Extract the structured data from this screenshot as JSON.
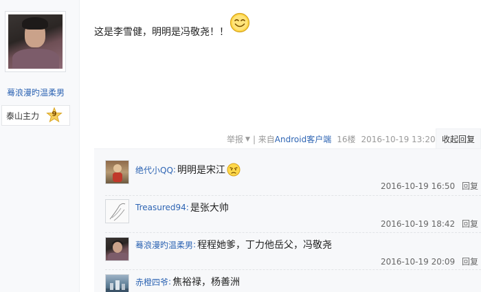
{
  "author": {
    "name": "蓦浪漫旳温柔男",
    "level_name": "泰山主力",
    "level_num": "9"
  },
  "post": {
    "text": "这是李雪健，明明是冯敬尧！！",
    "report": "举报",
    "source_prefix": "| 来自",
    "source_client": "Android客户端",
    "floor": "16楼",
    "time": "2016-10-19 13:20",
    "collapse_label": "收起回复"
  },
  "replies": [
    {
      "user": "绝代小QQ",
      "colon": ":",
      "text": "明明是宋江",
      "time": "2016-10-19 16:50",
      "reply_label": "回复",
      "avatar": "avatar-figure"
    },
    {
      "user": "Treasured94",
      "colon": ":",
      "text": "是张大帅",
      "time": "2016-10-19 18:42",
      "reply_label": "回复",
      "avatar": "avatar-sketch"
    },
    {
      "user": "蓦浪漫旳温柔男",
      "colon": ":",
      "text": "程程她爹，丁力他岳父，冯敬尧",
      "time": "2016-10-19 20:09",
      "reply_label": "回复",
      "avatar": "avatar-portrait"
    },
    {
      "user": "赤橙四爷",
      "colon": ":",
      "text": "焦裕禄，杨善洲",
      "time": "",
      "reply_label": "",
      "avatar": "avatar-landscape"
    }
  ],
  "icons": {
    "smiley": "smiley-icon",
    "star": "star-badge-icon",
    "caret": "caret-down-icon",
    "annoyed": "annoyed-emoji-icon"
  },
  "colors": {
    "link": "#2d64b3",
    "muted": "#999999",
    "reply_bg": "#f7f8fa"
  }
}
